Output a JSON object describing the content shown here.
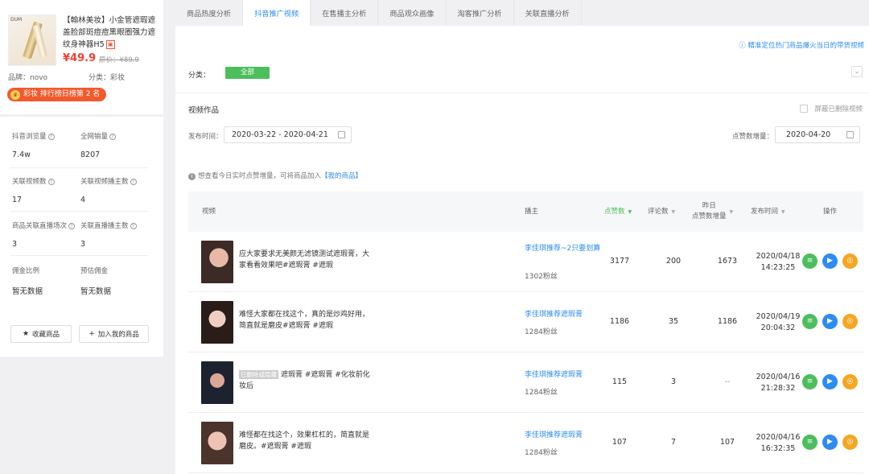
{
  "product": {
    "brand_logo": "DUM",
    "title_tag": "【翰林美妆】",
    "title": "小金管遮瑕遮盖脸部斑痘痘黑眼圈强力遮纹身神器H5",
    "price": "¥49.9",
    "orig_price": "原价：¥89.9",
    "brand": "品牌：novo",
    "category": "分类：彩妆",
    "rank_badge": "彩妆 排行榜日榜第 2 名"
  },
  "stats": [
    {
      "label": "抖音浏览量",
      "value": "7.4w"
    },
    {
      "label": "全网销量",
      "value": "8207"
    },
    {
      "label": "关联视频数",
      "value": "17"
    },
    {
      "label": "关联视频播主数",
      "value": "4"
    },
    {
      "label": "商品关联直播场次",
      "value": "3"
    },
    {
      "label": "关联直播播主数",
      "value": "3"
    },
    {
      "label": "佣金比例",
      "value": "暂无数据"
    },
    {
      "label": "预估佣金",
      "value": "暂无数据"
    }
  ],
  "actions": {
    "collect": "收藏商品",
    "add": "加入我的商品"
  },
  "tabs": [
    "商品热度分析",
    "抖音推广视频",
    "在售播主分析",
    "商品观众画像",
    "淘客推广分析",
    "关联直播分析"
  ],
  "help_link": "精准定位热门商品爆火当日的带货视频",
  "filter": {
    "label": "分类：",
    "all": "全部"
  },
  "section_title": "视频作品",
  "hide_deleted": "屏蔽已删除视频",
  "date_filter": {
    "label": "发布时间：",
    "value": "2020-03-22 - 2020-04-21"
  },
  "like_date": {
    "label": "点赞数增量：",
    "value": "2020-04-20"
  },
  "tip": {
    "text": "想查看今日实时点赞增量，可将商品加入",
    "link": "【我的商品】"
  },
  "table": {
    "headers": {
      "video": "视频",
      "anchor": "播主",
      "likes": "点赞数",
      "comments": "评论数",
      "yesterday1": "昨日",
      "yesterday2": "点赞数增量",
      "pubtime": "发布时间",
      "ops": "操作"
    },
    "rows": [
      {
        "tag": "",
        "desc": "应大家要求无美颜无滤镜测试遮瑕膏，大家看看效果吧#遮瑕膏 #遮瑕",
        "anchor": "李佳琪推荐~2只要划算",
        "fans": "1302粉丝",
        "likes": "3177",
        "comments": "200",
        "yesterday": "1673",
        "date": "2020/04/18",
        "time": "14:23:25"
      },
      {
        "tag": "",
        "desc": "难怪大家都在找这个，真的是炒鸡好用，简直就是磨皮#遮瑕膏 #遮瑕",
        "anchor": "李佳琪推荐遮瑕膏",
        "fans": "1284粉丝",
        "likes": "1186",
        "comments": "35",
        "yesterday": "1186",
        "date": "2020/04/19",
        "time": "20:04:32"
      },
      {
        "tag": "已删除或隐藏",
        "desc": "遮瑕膏 #遮瑕膏 #化妆前化妆后",
        "anchor": "李佳琪推荐遮瑕膏",
        "fans": "1284粉丝",
        "likes": "115",
        "comments": "3",
        "yesterday": "--",
        "date": "2020/04/16",
        "time": "21:28:32"
      },
      {
        "tag": "",
        "desc": "难怪都在找这个，效果杠杠的，简直就是磨皮。#遮瑕膏 #遮瑕",
        "anchor": "李佳琪推荐遮瑕膏",
        "fans": "1284粉丝",
        "likes": "107",
        "comments": "7",
        "yesterday": "107",
        "date": "2020/04/16",
        "time": "16:32:35"
      }
    ]
  },
  "colors": {
    "accent_blue": "#2d8cf0",
    "green": "#4cbe5c",
    "orange": "#f5a623",
    "price_red": "#f04030"
  }
}
